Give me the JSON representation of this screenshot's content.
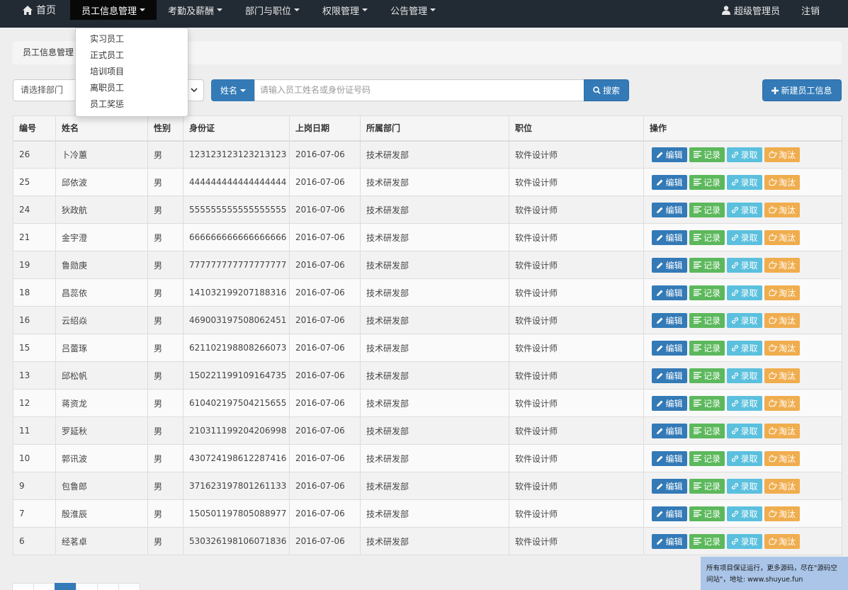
{
  "navbar": {
    "home_label": "首页",
    "items": [
      {
        "label": "员工信息管理",
        "active": true
      },
      {
        "label": "考勤及薪酬",
        "active": false
      },
      {
        "label": "部门与职位",
        "active": false
      },
      {
        "label": "权限管理",
        "active": false
      },
      {
        "label": "公告管理",
        "active": false
      }
    ],
    "user_label": "超级管理员",
    "logout_label": "注销"
  },
  "dropdown": {
    "items": [
      "实习员工",
      "正式员工",
      "培训项目",
      "离职员工",
      "员工奖惩"
    ]
  },
  "breadcrumb": {
    "text": "员工信息管理"
  },
  "search": {
    "dept_placeholder": "请选择部门",
    "field_label": "姓名",
    "input_placeholder": "请输入员工姓名或身份证号码",
    "search_label": "搜索",
    "new_label": "新建员工信息"
  },
  "table": {
    "headers": [
      "编号",
      "姓名",
      "性别",
      "身份证",
      "上岗日期",
      "所属部门",
      "职位",
      "操作"
    ],
    "action_labels": {
      "edit": "编辑",
      "record": "记录",
      "hire": "录取",
      "eliminate": "淘汰"
    },
    "rows": [
      [
        "26",
        "卜冷蕙",
        "男",
        "123123123123213123",
        "2016-07-06",
        "技术研发部",
        "软件设计师"
      ],
      [
        "25",
        "邱依波",
        "男",
        "444444444444444444",
        "2016-07-06",
        "技术研发部",
        "软件设计师"
      ],
      [
        "24",
        "狄政航",
        "男",
        "555555555555555555",
        "2016-07-06",
        "技术研发部",
        "软件设计师"
      ],
      [
        "21",
        "金宇澄",
        "男",
        "666666666666666666",
        "2016-07-06",
        "技术研发部",
        "软件设计师"
      ],
      [
        "19",
        "鲁勋庚",
        "男",
        "777777777777777777",
        "2016-07-06",
        "技术研发部",
        "软件设计师"
      ],
      [
        "18",
        "昌蕊依",
        "男",
        "141032199207188316",
        "2016-07-06",
        "技术研发部",
        "软件设计师"
      ],
      [
        "16",
        "云绍焱",
        "男",
        "469003197508062451",
        "2016-07-06",
        "技术研发部",
        "软件设计师"
      ],
      [
        "15",
        "吕蕾琢",
        "男",
        "621102198808266073",
        "2016-07-06",
        "技术研发部",
        "软件设计师"
      ],
      [
        "13",
        "邱松帆",
        "男",
        "150221199109164735",
        "2016-07-06",
        "技术研发部",
        "软件设计师"
      ],
      [
        "12",
        "蒋资龙",
        "男",
        "610402197504215655",
        "2016-07-06",
        "技术研发部",
        "软件设计师"
      ],
      [
        "11",
        "罗延秋",
        "男",
        "210311199204206998",
        "2016-07-06",
        "技术研发部",
        "软件设计师"
      ],
      [
        "10",
        "郭讯波",
        "男",
        "430724198612287416",
        "2016-07-06",
        "技术研发部",
        "软件设计师"
      ],
      [
        "9",
        "包鲁郎",
        "男",
        "371623197801261133",
        "2016-07-06",
        "技术研发部",
        "软件设计师"
      ],
      [
        "7",
        "殷淮辰",
        "男",
        "150501197805088977",
        "2016-07-06",
        "技术研发部",
        "软件设计师"
      ],
      [
        "6",
        "经茗卓",
        "男",
        "530326198106071836",
        "2016-07-06",
        "技术研发部",
        "软件设计师"
      ]
    ]
  },
  "watermark": {
    "text": "所有项目保证运行，更多源码，尽在\"源码空间站\"，地址: www.shuyue.fun"
  },
  "colors": {
    "navbar_bg": "#222a33",
    "primary": "#337ab7",
    "success": "#5cb85c",
    "info": "#5bc0de",
    "warning": "#f0ad4e"
  }
}
